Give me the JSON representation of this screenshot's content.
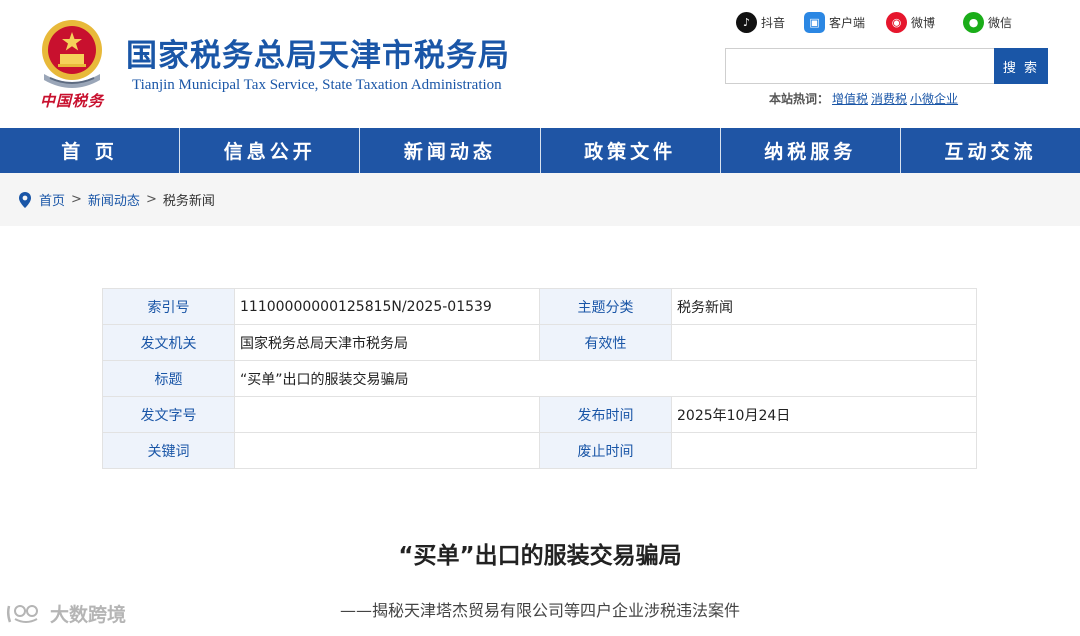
{
  "header": {
    "title": "国家税务总局天津市税务局",
    "subtitle": "Tianjin Municipal Tax Service, State Taxation Administration",
    "calligraphy": "中国税务"
  },
  "social": [
    {
      "label": "抖音",
      "icon": "douyin-icon"
    },
    {
      "label": "客户端",
      "icon": "client-app-icon"
    },
    {
      "label": "微博",
      "icon": "weibo-icon"
    },
    {
      "label": "微信",
      "icon": "wechat-icon"
    }
  ],
  "search": {
    "placeholder": "",
    "button_label": "搜 索",
    "hot_label": "本站热词：",
    "hot_words": [
      "增值税",
      "消费税",
      "小微企业"
    ]
  },
  "nav": [
    "首 页",
    "信息公开",
    "新闻动态",
    "政策文件",
    "纳税服务",
    "互动交流"
  ],
  "breadcrumb": [
    "首页",
    "新闻动态",
    "税务新闻"
  ],
  "info": {
    "index_label": "索引号",
    "index_value": "11100000000125815N/2025-01539",
    "category_label": "主题分类",
    "category_value": "税务新闻",
    "issuer_label": "发文机关",
    "issuer_value": "国家税务总局天津市税务局",
    "validity_label": "有效性",
    "validity_value": "",
    "title_label": "标题",
    "title_value": "“买单”出口的服装交易骗局",
    "doc_no_label": "发文字号",
    "doc_no_value": "",
    "publish_label": "发布时间",
    "publish_value": "2025年10月24日",
    "keywords_label": "关键词",
    "keywords_value": "",
    "expire_label": "废止时间",
    "expire_value": ""
  },
  "article": {
    "title": "“买单”出口的服装交易骗局",
    "subtitle": "——揭秘天津塔杰贸易有限公司等四户企业涉税违法案件"
  },
  "watermark": "大数跨境",
  "colors": {
    "brand_blue": "#1f55a5",
    "emblem_red": "#c8102e",
    "emblem_gold": "#e8b93a"
  }
}
